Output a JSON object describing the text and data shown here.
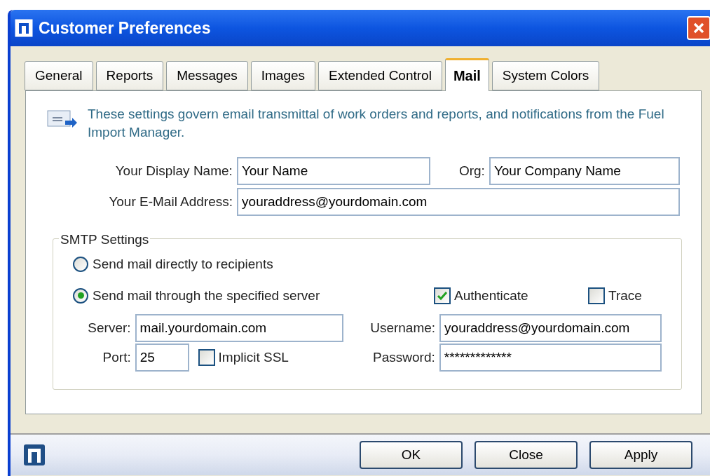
{
  "window": {
    "title": "Customer Preferences"
  },
  "tabs": [
    {
      "label": "General",
      "selected": false
    },
    {
      "label": "Reports",
      "selected": false
    },
    {
      "label": "Messages",
      "selected": false
    },
    {
      "label": "Images",
      "selected": false
    },
    {
      "label": "Extended Control",
      "selected": false
    },
    {
      "label": "Mail",
      "selected": true
    },
    {
      "label": "System Colors",
      "selected": false
    }
  ],
  "intro": "These settings govern email transmittal of work orders and reports, and notifications from the Fuel Import Manager.",
  "display_name": {
    "label": "Your Display Name:",
    "value": "Your Name"
  },
  "org": {
    "label": "Org:",
    "value": "Your Company Name"
  },
  "email": {
    "label": "Your E-Mail Address:",
    "value": "youraddress@yourdomain.com"
  },
  "smtp": {
    "title": "SMTP Settings",
    "modes": [
      {
        "label": "Send mail directly to recipients",
        "selected": false
      },
      {
        "label": "Send mail through the specified server",
        "selected": true
      }
    ],
    "authenticate": {
      "label": "Authenticate",
      "checked": true
    },
    "trace": {
      "label": "Trace",
      "checked": false
    },
    "server": {
      "label": "Server:",
      "value": "mail.yourdomain.com"
    },
    "port": {
      "label": "Port:",
      "value": "25"
    },
    "implicit_ssl": {
      "label": "Implicit SSL",
      "checked": false
    },
    "username": {
      "label": "Username:",
      "value": "youraddress@yourdomain.com"
    },
    "password": {
      "label": "Password:",
      "value": "*************"
    }
  },
  "buttons": [
    "OK",
    "Close",
    "Apply"
  ]
}
